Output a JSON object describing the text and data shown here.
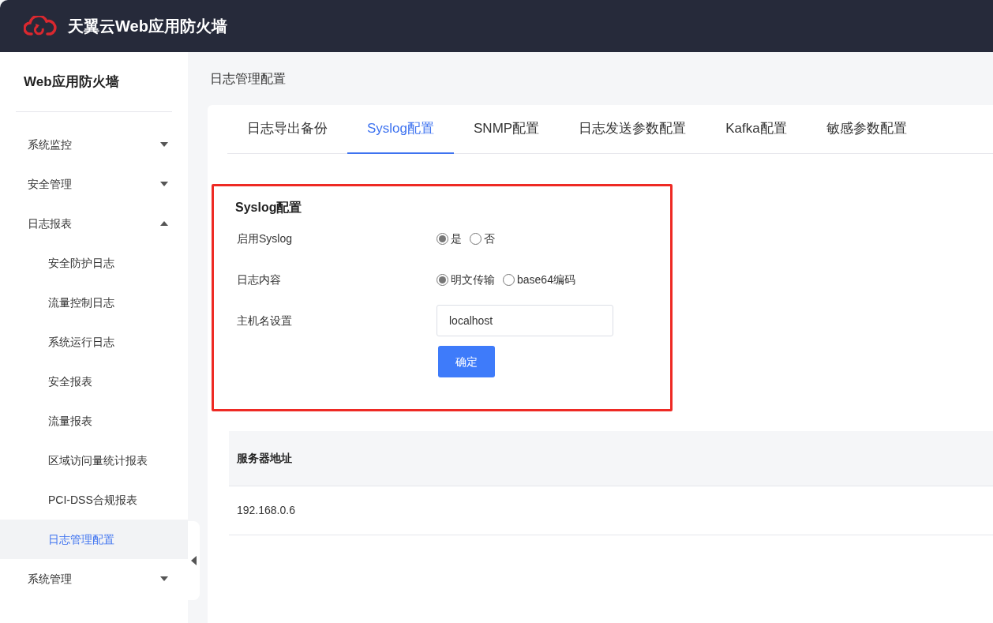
{
  "header": {
    "title": "天翼云Web应用防火墙"
  },
  "sidebar": {
    "title": "Web应用防火墙",
    "items": [
      {
        "label": "系统监控",
        "expanded": false
      },
      {
        "label": "安全管理",
        "expanded": false
      },
      {
        "label": "日志报表",
        "expanded": true,
        "children": [
          {
            "label": "安全防护日志",
            "selected": false
          },
          {
            "label": "流量控制日志",
            "selected": false
          },
          {
            "label": "系统运行日志",
            "selected": false
          },
          {
            "label": "安全报表",
            "selected": false
          },
          {
            "label": "流量报表",
            "selected": false
          },
          {
            "label": "区域访问量统计报表",
            "selected": false
          },
          {
            "label": "PCI-DSS合规报表",
            "selected": false
          },
          {
            "label": "日志管理配置",
            "selected": true
          }
        ]
      },
      {
        "label": "系统管理",
        "expanded": false
      }
    ]
  },
  "breadcrumb": "日志管理配置",
  "tabs": [
    {
      "label": "日志导出备份",
      "selected": false
    },
    {
      "label": "Syslog配置",
      "selected": true
    },
    {
      "label": "SNMP配置",
      "selected": false
    },
    {
      "label": "日志发送参数配置",
      "selected": false
    },
    {
      "label": "Kafka配置",
      "selected": false
    },
    {
      "label": "敏感参数配置",
      "selected": false
    }
  ],
  "form": {
    "title": "Syslog配置",
    "fields": [
      {
        "kind": "radio",
        "label": "启用Syslog",
        "options": [
          {
            "label": "是",
            "selected": true
          },
          {
            "label": "否",
            "selected": false
          }
        ]
      },
      {
        "kind": "radio",
        "label": "日志内容",
        "options": [
          {
            "label": "明文传输",
            "selected": true
          },
          {
            "label": "base64编码",
            "selected": false
          }
        ]
      },
      {
        "kind": "text",
        "label": "主机名设置",
        "value": "localhost"
      }
    ],
    "submit": "确定"
  },
  "table": {
    "columns": [
      "服务器地址"
    ],
    "rows": [
      [
        "192.168.0.6"
      ]
    ]
  }
}
